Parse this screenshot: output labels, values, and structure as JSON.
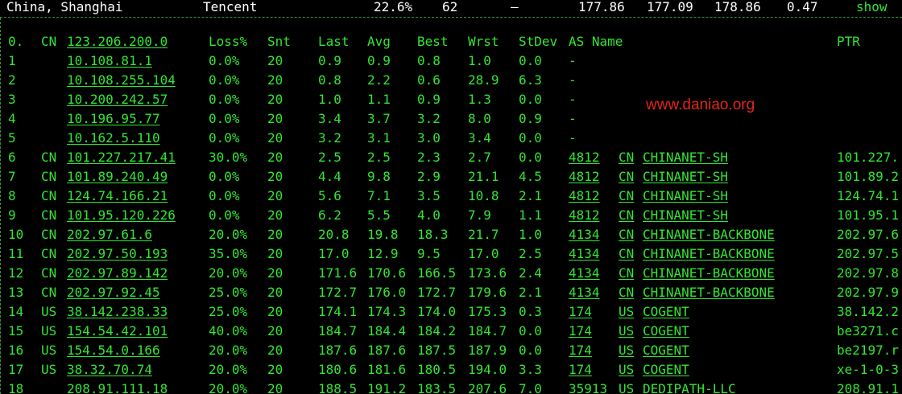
{
  "top_row": {
    "location": "China, Shanghai",
    "provider": "Tencent",
    "loss": "22.6%",
    "snt": "62",
    "dash": "–",
    "last": "177.86",
    "avg": "177.09",
    "best": "178.86",
    "stdev": "0.47",
    "action": "show"
  },
  "header": {
    "hop": "0.",
    "cc": "CN",
    "host": "123.206.200.0",
    "loss": "Loss%",
    "snt": "Snt",
    "last": "Last",
    "avg": "Avg",
    "best": "Best",
    "wrst": "Wrst",
    "stdev": "StDev",
    "as_name": "AS Name",
    "ptr": "PTR"
  },
  "watermark": "www.daniao.org",
  "hops": [
    {
      "hop": "1",
      "cc": "",
      "host": "10.108.81.1",
      "loss": "0.0%",
      "snt": "20",
      "last": "0.9",
      "avg": "0.9",
      "best": "0.8",
      "wrst": "1.0",
      "stdev": "0.0",
      "asn": "-",
      "as_cc": "",
      "as_name": "",
      "ptr": ""
    },
    {
      "hop": "2",
      "cc": "",
      "host": "10.108.255.104",
      "loss": "0.0%",
      "snt": "20",
      "last": "0.8",
      "avg": "2.2",
      "best": "0.6",
      "wrst": "28.9",
      "stdev": "6.3",
      "asn": "-",
      "as_cc": "",
      "as_name": "",
      "ptr": ""
    },
    {
      "hop": "3",
      "cc": "",
      "host": "10.200.242.57",
      "loss": "0.0%",
      "snt": "20",
      "last": "1.0",
      "avg": "1.1",
      "best": "0.9",
      "wrst": "1.3",
      "stdev": "0.0",
      "asn": "-",
      "as_cc": "",
      "as_name": "",
      "ptr": ""
    },
    {
      "hop": "4",
      "cc": "",
      "host": "10.196.95.77",
      "loss": "0.0%",
      "snt": "20",
      "last": "3.4",
      "avg": "3.7",
      "best": "3.2",
      "wrst": "8.0",
      "stdev": "0.9",
      "asn": "-",
      "as_cc": "",
      "as_name": "",
      "ptr": ""
    },
    {
      "hop": "5",
      "cc": "",
      "host": "10.162.5.110",
      "loss": "0.0%",
      "snt": "20",
      "last": "3.2",
      "avg": "3.1",
      "best": "3.0",
      "wrst": "3.4",
      "stdev": "0.0",
      "asn": "-",
      "as_cc": "",
      "as_name": "",
      "ptr": ""
    },
    {
      "hop": "6",
      "cc": "CN",
      "host": "101.227.217.41",
      "loss": "30.0%",
      "snt": "20",
      "last": "2.5",
      "avg": "2.5",
      "best": "2.3",
      "wrst": "2.7",
      "stdev": "0.0",
      "asn": "4812",
      "as_cc": "CN",
      "as_name": "CHINANET-SH",
      "ptr": "101.227."
    },
    {
      "hop": "7",
      "cc": "CN",
      "host": "101.89.240.49",
      "loss": "0.0%",
      "snt": "20",
      "last": "4.4",
      "avg": "9.8",
      "best": "2.9",
      "wrst": "21.1",
      "stdev": "4.5",
      "asn": "4812",
      "as_cc": "CN",
      "as_name": "CHINANET-SH",
      "ptr": "101.89.2"
    },
    {
      "hop": "8",
      "cc": "CN",
      "host": "124.74.166.21",
      "loss": "0.0%",
      "snt": "20",
      "last": "5.6",
      "avg": "7.1",
      "best": "3.5",
      "wrst": "10.8",
      "stdev": "2.1",
      "asn": "4812",
      "as_cc": "CN",
      "as_name": "CHINANET-SH",
      "ptr": "124.74.1"
    },
    {
      "hop": "9",
      "cc": "CN",
      "host": "101.95.120.226",
      "loss": "0.0%",
      "snt": "20",
      "last": "6.2",
      "avg": "5.5",
      "best": "4.0",
      "wrst": "7.9",
      "stdev": "1.1",
      "asn": "4812",
      "as_cc": "CN",
      "as_name": "CHINANET-SH",
      "ptr": "101.95.1"
    },
    {
      "hop": "10",
      "cc": "CN",
      "host": "202.97.61.6",
      "loss": "20.0%",
      "snt": "20",
      "last": "20.8",
      "avg": "19.8",
      "best": "18.3",
      "wrst": "21.7",
      "stdev": "1.0",
      "asn": "4134",
      "as_cc": "CN",
      "as_name": "CHINANET-BACKBONE",
      "ptr": "202.97.6"
    },
    {
      "hop": "11",
      "cc": "CN",
      "host": "202.97.50.193",
      "loss": "35.0%",
      "snt": "20",
      "last": "17.0",
      "avg": "12.9",
      "best": "9.5",
      "wrst": "17.0",
      "stdev": "2.5",
      "asn": "4134",
      "as_cc": "CN",
      "as_name": "CHINANET-BACKBONE",
      "ptr": "202.97.5"
    },
    {
      "hop": "12",
      "cc": "CN",
      "host": "202.97.89.142",
      "loss": "20.0%",
      "snt": "20",
      "last": "171.6",
      "avg": "170.6",
      "best": "166.5",
      "wrst": "173.6",
      "stdev": "2.4",
      "asn": "4134",
      "as_cc": "CN",
      "as_name": "CHINANET-BACKBONE",
      "ptr": "202.97.8"
    },
    {
      "hop": "13",
      "cc": "CN",
      "host": "202.97.92.45",
      "loss": "25.0%",
      "snt": "20",
      "last": "172.7",
      "avg": "176.0",
      "best": "172.7",
      "wrst": "179.6",
      "stdev": "2.1",
      "asn": "4134",
      "as_cc": "CN",
      "as_name": "CHINANET-BACKBONE",
      "ptr": "202.97.9"
    },
    {
      "hop": "14",
      "cc": "US",
      "host": "38.142.238.33",
      "loss": "25.0%",
      "snt": "20",
      "last": "174.1",
      "avg": "174.3",
      "best": "174.0",
      "wrst": "175.3",
      "stdev": "0.3",
      "asn": "174",
      "as_cc": "US",
      "as_name": "COGENT",
      "ptr": "38.142.2"
    },
    {
      "hop": "15",
      "cc": "US",
      "host": "154.54.42.101",
      "loss": "40.0%",
      "snt": "20",
      "last": "184.7",
      "avg": "184.4",
      "best": "184.2",
      "wrst": "184.7",
      "stdev": "0.0",
      "asn": "174",
      "as_cc": "US",
      "as_name": "COGENT",
      "ptr": "be3271.c"
    },
    {
      "hop": "16",
      "cc": "US",
      "host": "154.54.0.166",
      "loss": "20.0%",
      "snt": "20",
      "last": "187.6",
      "avg": "187.6",
      "best": "187.5",
      "wrst": "187.9",
      "stdev": "0.0",
      "asn": "174",
      "as_cc": "US",
      "as_name": "COGENT",
      "ptr": "be2197.r"
    },
    {
      "hop": "17",
      "cc": "US",
      "host": "38.32.70.74",
      "loss": "20.0%",
      "snt": "20",
      "last": "180.6",
      "avg": "181.6",
      "best": "180.5",
      "wrst": "194.0",
      "stdev": "3.3",
      "asn": "174",
      "as_cc": "US",
      "as_name": "COGENT",
      "ptr": "xe-1-0-3"
    },
    {
      "hop": "18",
      "cc": "",
      "host": "208.91.111.18",
      "loss": "20.0%",
      "snt": "20",
      "last": "188.5",
      "avg": "191.2",
      "best": "183.5",
      "wrst": "207.6",
      "stdev": "7.0",
      "asn": "35913",
      "as_cc": "US",
      "as_name": "DEDIPATH-LLC",
      "ptr": "208.91.1"
    }
  ],
  "colors": {
    "background": "#000000",
    "text_green": "#32e632",
    "title_white": "#ffffff",
    "watermark_red": "#e2261c",
    "divider": "#3b8f3b"
  }
}
